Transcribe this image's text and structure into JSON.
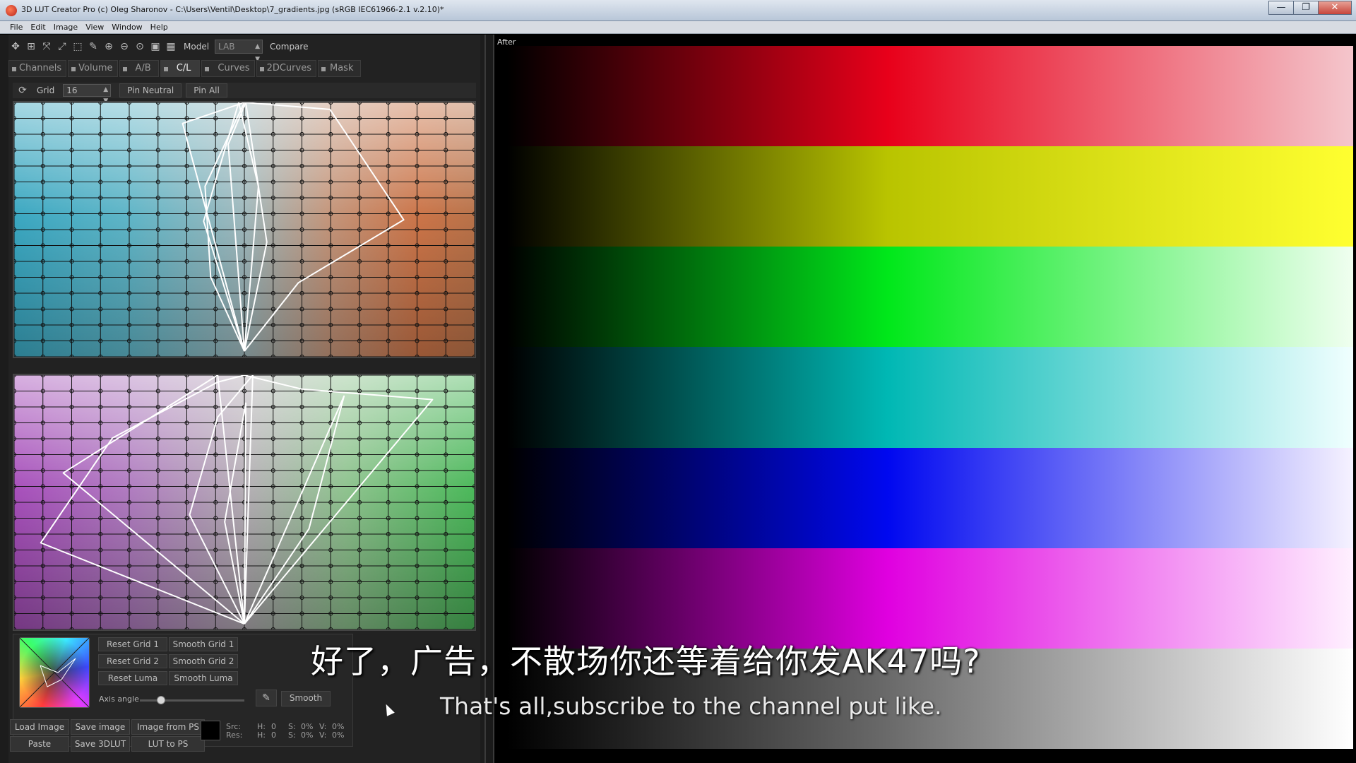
{
  "window": {
    "title": "3D LUT Creator Pro (c) Oleg Sharonov - C:\\Users\\Ventil\\Desktop\\7_gradients.jpg (sRGB IEC61966-2.1 v.2.10)*",
    "minimize": "—",
    "maximize": "❐",
    "close": "✕"
  },
  "menu": [
    "File",
    "Edit",
    "Image",
    "View",
    "Window",
    "Help"
  ],
  "toolbar": {
    "icons": [
      "move-icon",
      "grid-icon",
      "fit-icon",
      "expand-icon",
      "select-icon",
      "eyedropper-icon",
      "zoom-in-icon",
      "zoom-out-icon",
      "zoom-fit-icon",
      "zoom-actual-icon",
      "layout-icon"
    ],
    "glyphs": [
      "✥",
      "⊞",
      "⤧",
      "⤢",
      "⬚",
      "✎",
      "⊕",
      "⊖",
      "⊙",
      "▣",
      "▦"
    ],
    "model_label": "Model",
    "model_value": "LAB",
    "compare_label": "Compare"
  },
  "tabs": [
    {
      "label": "Channels",
      "active": false
    },
    {
      "label": "Volume",
      "active": false
    },
    {
      "label": "A/B",
      "active": false
    },
    {
      "label": "C/L",
      "active": true
    },
    {
      "label": "Curves",
      "active": false
    },
    {
      "label": "2DCurves",
      "active": false
    },
    {
      "label": "Mask",
      "active": false
    }
  ],
  "gridbar": {
    "refresh": "⟳",
    "grid_label": "Grid",
    "grid_value": "16",
    "pin_neutral": "Pin Neutral",
    "pin_all": "Pin All"
  },
  "controls": {
    "reset_grid_1": "Reset Grid 1",
    "smooth_grid_1": "Smooth Grid 1",
    "reset_grid_2": "Reset Grid 2",
    "smooth_grid_2": "Smooth Grid 2",
    "reset_luma": "Reset Luma",
    "smooth_luma": "Smooth Luma",
    "axis_angle_label": "Axis angle",
    "axis_angle_level": 0.2,
    "smooth": "Smooth",
    "picker": "✎"
  },
  "actions": {
    "load_image": "Load Image",
    "save_image": "Save image",
    "image_from_ps": "Image from PS",
    "paste": "Paste",
    "save_3dlut": "Save 3DLUT",
    "lut_to_ps": "LUT to PS"
  },
  "info": {
    "src_label": "Src:",
    "res_label": "Res:",
    "h_label": "H:",
    "s_label": "S:",
    "v_label": "V:",
    "src_h": "0",
    "src_s": "0%",
    "src_v": "0%",
    "res_h": "0",
    "res_s": "0%",
    "res_v": "0%"
  },
  "view": {
    "label": "After",
    "bands": [
      {
        "mid": "#e8001a",
        "end": "#f4c6cc"
      },
      {
        "mid": "#b9c400",
        "end": "#ffff30"
      },
      {
        "mid": "#00e81a",
        "end": "#f0fff0"
      },
      {
        "mid": "#00b8b4",
        "end": "#f0ffff"
      },
      {
        "mid": "#0008f0",
        "end": "#f6f2ff"
      },
      {
        "mid": "#e000e0",
        "end": "#fff0ff"
      },
      {
        "mid": "#6a6a6a",
        "end": "#ffffff"
      }
    ]
  },
  "subtitles": {
    "cn": "好了，广告，不散场你还等着给你发AK47吗?",
    "en": "That's all,subscribe to the channel put like."
  },
  "colors": {
    "active_tab": "#3a3a3a",
    "panel": "#222222"
  }
}
